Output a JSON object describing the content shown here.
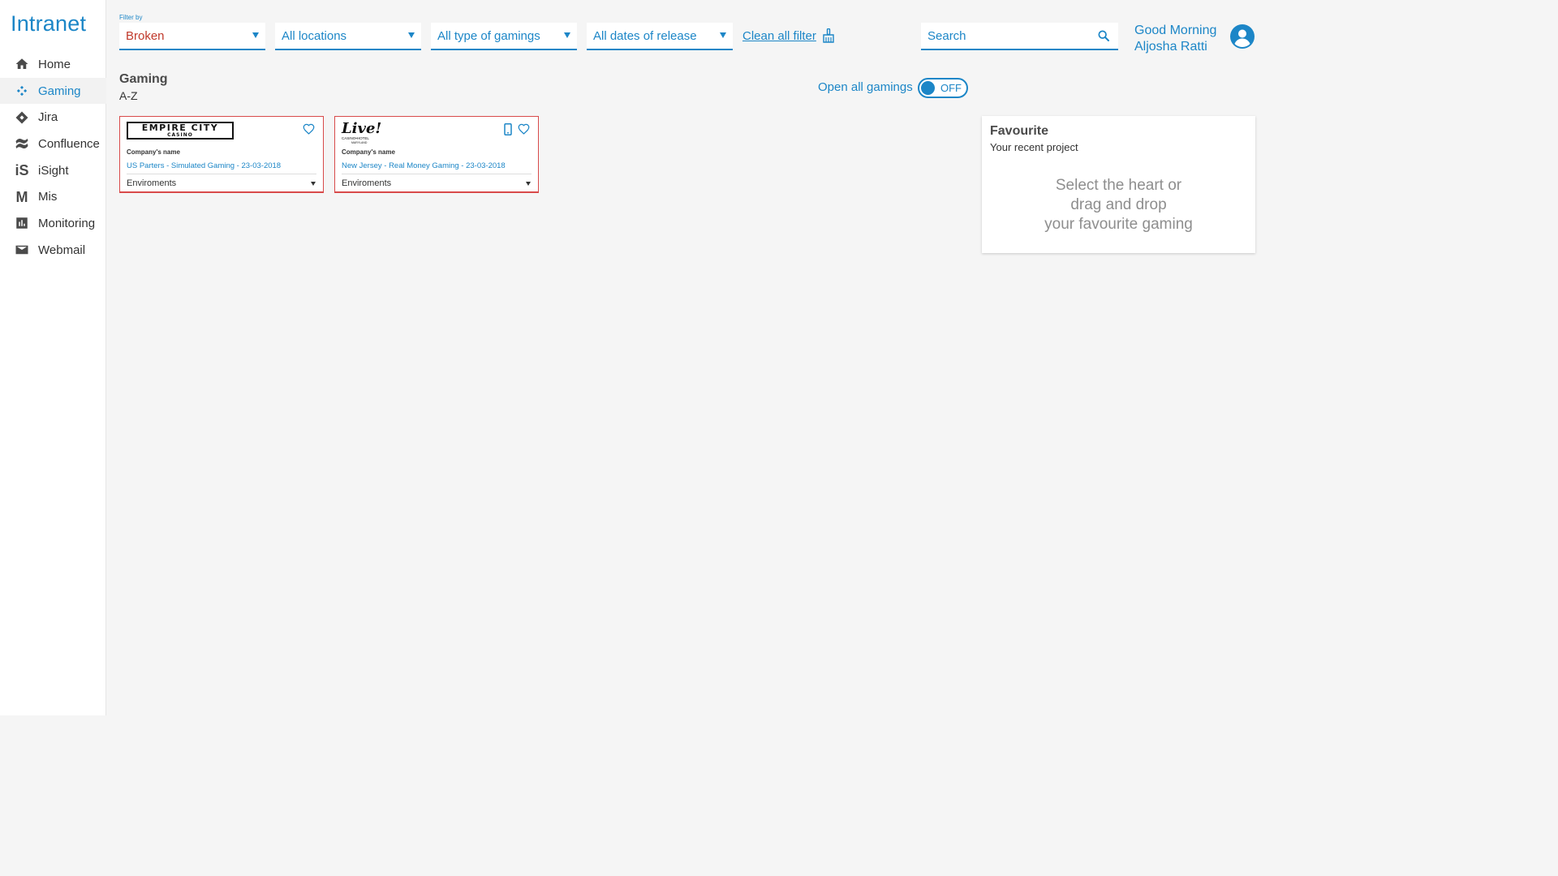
{
  "brand": "Intranet",
  "nav": [
    {
      "label": "Home",
      "icon": "home-icon"
    },
    {
      "label": "Gaming",
      "icon": "gamepad-icon",
      "active": true
    },
    {
      "label": "Jira",
      "icon": "jira-icon"
    },
    {
      "label": "Confluence",
      "icon": "confluence-icon"
    },
    {
      "label": "iSight",
      "icon": "isight-icon",
      "glyph": "iS"
    },
    {
      "label": "Mis",
      "icon": "mis-icon",
      "glyph": "M"
    },
    {
      "label": "Monitoring",
      "icon": "chart-icon"
    },
    {
      "label": "Webmail",
      "icon": "mail-icon"
    }
  ],
  "filters": {
    "label": "Filter by",
    "status": "Broken",
    "locations": "All locations",
    "types": "All type of gamings",
    "dates": "All dates of release",
    "clean": "Clean all filter"
  },
  "search": {
    "placeholder": "Search"
  },
  "user": {
    "greeting": "Good Morning",
    "name": "Aljosha Ratti"
  },
  "section": {
    "title": "Gaming",
    "sort": "A-Z"
  },
  "open_all": {
    "label": "Open all gamings",
    "state": "OFF"
  },
  "cards": [
    {
      "logo_line1": "EMPIRE CITY",
      "logo_line2": "CASINO",
      "company": "Company's name",
      "info": "US Parters - Simulated Gaming - 23-03-2018",
      "envs": "Enviroments"
    },
    {
      "logo_line1": "Live!",
      "logo_line2": "CASINO•HOTEL",
      "logo_line3": "MARYLAND",
      "company": "Company's name",
      "info": "New Jersey - Real Money Gaming - 23-03-2018",
      "envs": "Enviroments"
    }
  ],
  "favourite": {
    "title": "Favourite",
    "subtitle": "Your recent project",
    "message_line1": "Select the heart or",
    "message_line2": "drag and drop",
    "message_line3": "your favourite gaming"
  },
  "colors": {
    "accent": "#1c86c7",
    "alert": "#d84a4a",
    "muted": "#8e8e8e"
  }
}
